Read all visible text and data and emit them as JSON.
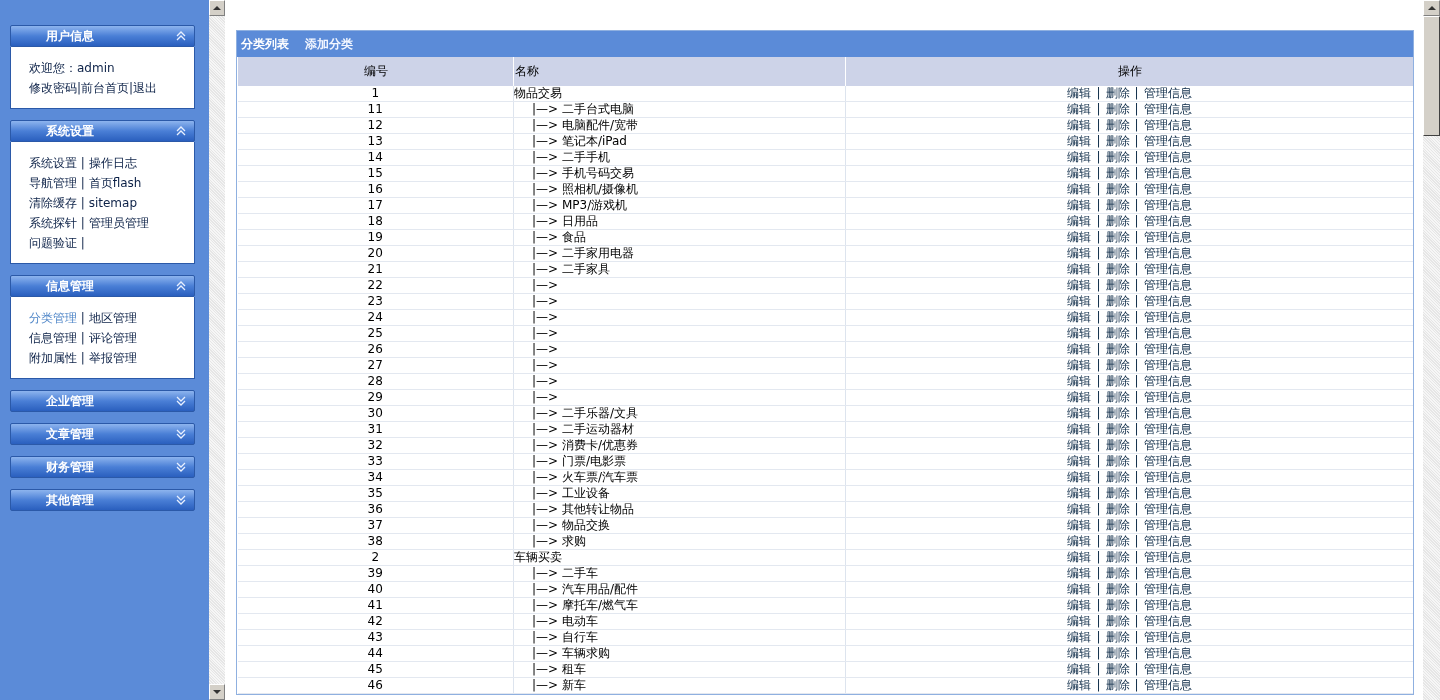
{
  "sidebar": {
    "panels": [
      {
        "title": "用户信息",
        "expanded": true,
        "lines": [
          {
            "kind": "text",
            "text": "欢迎您：admin"
          },
          {
            "kind": "links",
            "items": [
              {
                "text": "修改密码",
                "selected": false
              },
              "|",
              {
                "text": "前台首页",
                "selected": false
              },
              "|",
              {
                "text": "退出",
                "selected": false
              }
            ]
          }
        ]
      },
      {
        "title": "系统设置",
        "expanded": true,
        "lines": [
          {
            "kind": "links",
            "items": [
              {
                "text": "系统设置",
                "selected": false
              },
              " | ",
              {
                "text": "操作日志",
                "selected": false
              }
            ]
          },
          {
            "kind": "links",
            "items": [
              {
                "text": "导航管理",
                "selected": false
              },
              " | ",
              {
                "text": "首页flash",
                "selected": false
              }
            ]
          },
          {
            "kind": "links",
            "items": [
              {
                "text": "清除缓存",
                "selected": false
              },
              " | ",
              {
                "text": "sitemap",
                "selected": false
              }
            ]
          },
          {
            "kind": "links",
            "items": [
              {
                "text": "系统探针",
                "selected": false
              },
              " | ",
              {
                "text": "管理员管理",
                "selected": false
              }
            ]
          },
          {
            "kind": "links",
            "items": [
              {
                "text": "问题验证",
                "selected": false
              },
              " |"
            ]
          }
        ]
      },
      {
        "title": "信息管理",
        "expanded": true,
        "lines": [
          {
            "kind": "links",
            "items": [
              {
                "text": "分类管理",
                "selected": true
              },
              " | ",
              {
                "text": "地区管理",
                "selected": false
              }
            ]
          },
          {
            "kind": "links",
            "items": [
              {
                "text": "信息管理",
                "selected": false
              },
              " | ",
              {
                "text": "评论管理",
                "selected": false
              }
            ]
          },
          {
            "kind": "links",
            "items": [
              {
                "text": "附加属性",
                "selected": false
              },
              " | ",
              {
                "text": "举报管理",
                "selected": false
              }
            ]
          }
        ]
      },
      {
        "title": "企业管理",
        "expanded": false
      },
      {
        "title": "文章管理",
        "expanded": false
      },
      {
        "title": "财务管理",
        "expanded": false
      },
      {
        "title": "其他管理",
        "expanded": false
      }
    ]
  },
  "main": {
    "tabs": [
      {
        "label": "分类列表",
        "selected": true
      },
      {
        "label": "添加分类",
        "selected": false
      }
    ],
    "table": {
      "columns": [
        "编号",
        "名称",
        "操作"
      ],
      "rows": [
        {
          "id": "1",
          "name": "物品交易",
          "actions": [
            "编辑",
            "|",
            "删除",
            "|",
            "管理信息"
          ],
          "children": [
            {
              "id": "11",
              "prefix": "|—>",
              "name": "二手台式电脑",
              "actions": [
                "编辑",
                "|",
                "删除",
                "|",
                "管理信息"
              ]
            },
            {
              "id": "12",
              "prefix": "|—>",
              "name": "电脑配件/宽带",
              "actions": [
                "编辑",
                "|",
                "删除",
                "|",
                "管理信息"
              ]
            },
            {
              "id": "13",
              "prefix": "|—>",
              "name": "笔记本/iPad",
              "actions": [
                "编辑",
                "|",
                "删除",
                "|",
                "管理信息"
              ]
            },
            {
              "id": "14",
              "prefix": "|—>",
              "name": "二手手机",
              "actions": [
                "编辑",
                "|",
                "删除",
                "|",
                "管理信息"
              ]
            },
            {
              "id": "15",
              "prefix": "|—>",
              "name": "手机号码交易",
              "actions": [
                "编辑",
                "|",
                "删除",
                "|",
                "管理信息"
              ]
            },
            {
              "id": "16",
              "prefix": "|—>",
              "name": "照相机/摄像机",
              "actions": [
                "编辑",
                "|",
                "删除",
                "|",
                "管理信息"
              ]
            },
            {
              "id": "17",
              "prefix": "|—>",
              "name": "MP3/游戏机",
              "actions": [
                "编辑",
                "|",
                "删除",
                "|",
                "管理信息"
              ]
            },
            {
              "id": "18",
              "prefix": "|—>",
              "name": "日用品",
              "actions": [
                "编辑",
                "|",
                "删除",
                "|",
                "管理信息"
              ]
            },
            {
              "id": "19",
              "prefix": "|—>",
              "name": "食品",
              "actions": [
                "编辑",
                "|",
                "删除",
                "|",
                "管理信息"
              ]
            },
            {
              "id": "20",
              "prefix": "|—>",
              "name": "二手家用电器",
              "actions": [
                "编辑",
                "|",
                "删除",
                "|",
                "管理信息"
              ]
            },
            {
              "id": "21",
              "prefix": "|—>",
              "name": "二手家具",
              "actions": [
                "编辑",
                "|",
                "删除",
                "|",
                "管理信息"
              ]
            },
            {
              "id": "22",
              "prefix": "|—>",
              "actions": [
                "编辑",
                "|",
                "删除",
                "|",
                "管理信息"
              ]
            },
            {
              "id": "23",
              "prefix": "|—>",
              "actions": [
                "编辑",
                "|",
                "删除",
                "|",
                "管理信息"
              ]
            },
            {
              "id": "24",
              "prefix": "|—>",
              "actions": [
                "编辑",
                "|",
                "删除",
                "|",
                "管理信息"
              ]
            },
            {
              "id": "25",
              "prefix": "|—>",
              "actions": [
                "编辑",
                "|",
                "删除",
                "|",
                "管理信息"
              ]
            },
            {
              "id": "26",
              "prefix": "|—>",
              "actions": [
                "编辑",
                "|",
                "删除",
                "|",
                "管理信息"
              ]
            },
            {
              "id": "27",
              "prefix": "|—>",
              "actions": [
                "编辑",
                "|",
                "删除",
                "|",
                "管理信息"
              ]
            },
            {
              "id": "28",
              "prefix": "|—>",
              "actions": [
                "编辑",
                "|",
                "删除",
                "|",
                "管理信息"
              ]
            },
            {
              "id": "29",
              "prefix": "|—>",
              "actions": [
                "编辑",
                "|",
                "删除",
                "|",
                "管理信息"
              ]
            },
            {
              "id": "30",
              "prefix": "|—>",
              "name": "二手乐器/文具",
              "actions": [
                "编辑",
                "|",
                "删除",
                "|",
                "管理信息"
              ]
            },
            {
              "id": "31",
              "prefix": "|—>",
              "name": "二手运动器材",
              "actions": [
                "编辑",
                "|",
                "删除",
                "|",
                "管理信息"
              ]
            },
            {
              "id": "32",
              "prefix": "|—>",
              "name": "消费卡/优惠券",
              "actions": [
                "编辑",
                "|",
                "删除",
                "|",
                "管理信息"
              ]
            },
            {
              "id": "33",
              "prefix": "|—>",
              "name": "门票/电影票",
              "actions": [
                "编辑",
                "|",
                "删除",
                "|",
                "管理信息"
              ]
            },
            {
              "id": "34",
              "prefix": "|—>",
              "name": "火车票/汽车票",
              "actions": [
                "编辑",
                "|",
                "删除",
                "|",
                "管理信息"
              ]
            },
            {
              "id": "35",
              "prefix": "|—>",
              "name": "工业设备",
              "actions": [
                "编辑",
                "|",
                "删除",
                "|",
                "管理信息"
              ]
            },
            {
              "id": "36",
              "prefix": "|—>",
              "name": "其他转让物品",
              "actions": [
                "编辑",
                "|",
                "删除",
                "|",
                "管理信息"
              ]
            },
            {
              "id": "37",
              "prefix": "|—>",
              "name": "物品交换",
              "actions": [
                "编辑",
                "|",
                "删除",
                "|",
                "管理信息"
              ]
            },
            {
              "id": "38",
              "prefix": "|—>",
              "name": "求购",
              "actions": [
                "编辑",
                "|",
                "删除",
                "|",
                "管理信息"
              ]
            }
          ]
        },
        {
          "id": "2",
          "name": "车辆买卖",
          "actions": [
            "编辑",
            "|",
            "删除",
            "|",
            "管理信息"
          ],
          "children": [
            {
              "id": "39",
              "prefix": "|—>",
              "name": "二手车",
              "actions": [
                "编辑",
                "|",
                "删除",
                "|",
                "管理信息"
              ]
            },
            {
              "id": "40",
              "prefix": "|—>",
              "name": "汽车用品/配件",
              "actions": [
                "编辑",
                "|",
                "删除",
                "|",
                "管理信息"
              ]
            },
            {
              "id": "41",
              "prefix": "|—>",
              "name": "摩托车/燃气车",
              "actions": [
                "编辑",
                "|",
                "删除",
                "|",
                "管理信息"
              ]
            },
            {
              "id": "42",
              "prefix": "|—>",
              "name": "电动车",
              "actions": [
                "编辑",
                "|",
                "删除",
                "|",
                "管理信息"
              ]
            },
            {
              "id": "43",
              "prefix": "|—>",
              "name": "自行车",
              "actions": [
                "编辑",
                "|",
                "删除",
                "|",
                "管理信息"
              ]
            },
            {
              "id": "44",
              "prefix": "|—>",
              "name": "车辆求购",
              "actions": [
                "编辑",
                "|",
                "删除",
                "|",
                "管理信息"
              ]
            },
            {
              "id": "45",
              "prefix": "|—>",
              "name": "租车",
              "actions": [
                "编辑",
                "|",
                "删除",
                "|",
                "管理信息"
              ]
            },
            {
              "id": "46",
              "prefix": "|—>",
              "name": "新车",
              "actions": [
                "编辑",
                "|",
                "删除",
                "|",
                "管理信息"
              ]
            }
          ]
        }
      ]
    }
  }
}
